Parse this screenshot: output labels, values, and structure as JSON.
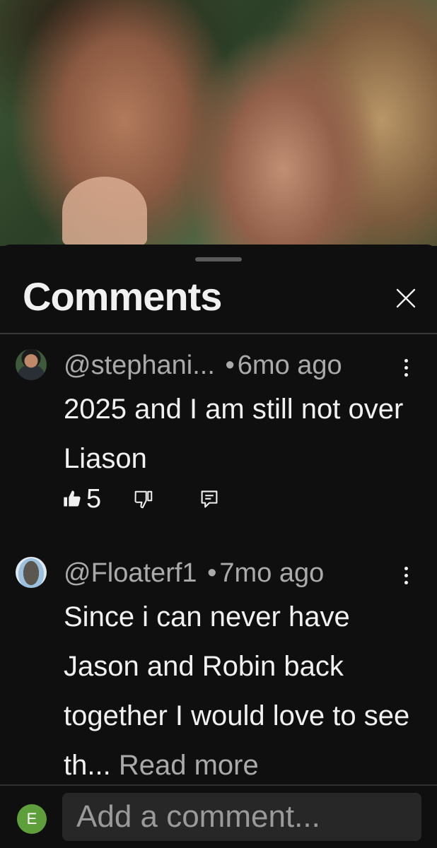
{
  "panel": {
    "title": "Comments"
  },
  "comments": [
    {
      "author": "@stephani...",
      "separator": "•",
      "time": "6mo ago",
      "text": "2025 and I am still not over Liason",
      "likes": "5"
    },
    {
      "author": "@Floaterf1",
      "separator": "•",
      "time": "7mo ago",
      "text": "Since i can never have Jason and Robin back together I would love to see th...",
      "read_more": "Read more"
    }
  ],
  "composer": {
    "avatar_initial": "E",
    "placeholder": "Add a comment..."
  },
  "colors": {
    "background": "#0f0f0f",
    "text_primary": "#f1f1f1",
    "text_secondary": "#aaaaaa",
    "input_bg": "#272727",
    "composer_avatar": "#5e9e3b"
  },
  "icons": [
    "close-icon",
    "more-vert-icon",
    "thumb-up-icon",
    "thumb-down-icon",
    "reply-icon"
  ]
}
